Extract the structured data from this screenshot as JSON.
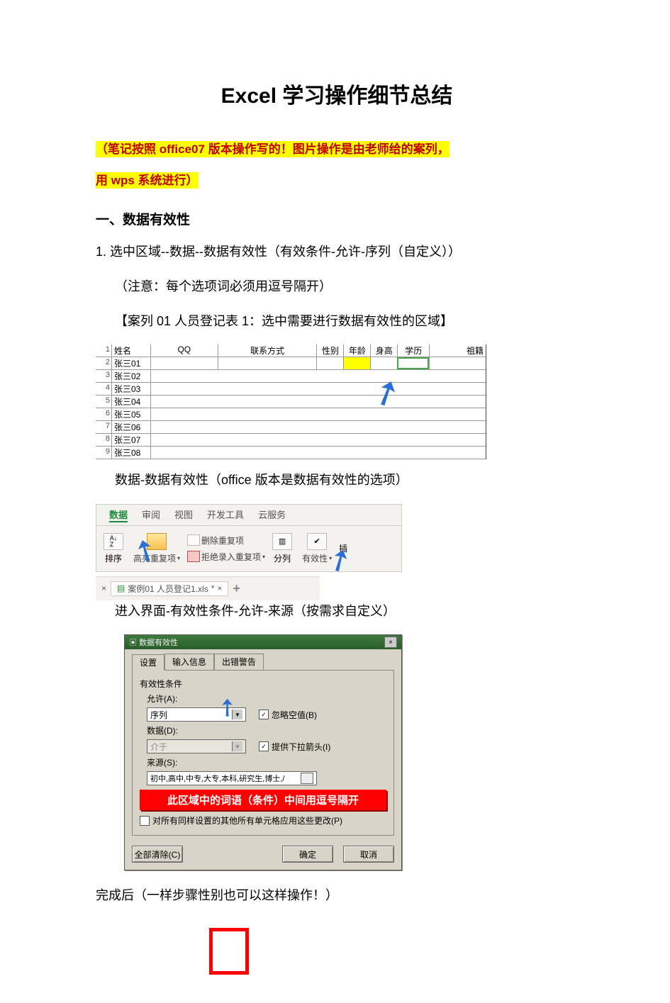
{
  "title": "Excel 学习操作细节总结",
  "highlight_line1": "（笔记按照 office07 版本操作写的！图片操作是由老师给的案列，",
  "highlight_line2": "用 wps 系统进行）",
  "section1_head": "一、数据有效性",
  "line_1_1": "1. 选中区域--数据--数据有效性（有效条件-允许-序列（自定义））",
  "line_1_2": "（注意：每个选项词必须用逗号隔开）",
  "case_title": "【案列 01 人员登记表 1：选中需要进行数据有效性的区域】",
  "sheet": {
    "headers": {
      "name": "姓名",
      "qq": "QQ",
      "contact": "联系方式",
      "sex": "性别",
      "age": "年龄",
      "height": "身高",
      "edu": "学历",
      "home": "祖籍"
    },
    "rows": [
      {
        "num": "2",
        "name": "张三01"
      },
      {
        "num": "3",
        "name": "张三02"
      },
      {
        "num": "4",
        "name": "张三03"
      },
      {
        "num": "5",
        "name": "张三04"
      },
      {
        "num": "6",
        "name": "张三05"
      },
      {
        "num": "7",
        "name": "张三06"
      },
      {
        "num": "8",
        "name": "张三07"
      },
      {
        "num": "9",
        "name": "张三08"
      }
    ]
  },
  "line_2_1": "数据-数据有效性（office 版本是数据有效性的选项）",
  "ribbon": {
    "tabs": [
      "数据",
      "审阅",
      "视图",
      "开发工具",
      "云服务"
    ],
    "active_tab": "数据",
    "sort_label": "排序",
    "highlight_dup": "高亮重复项",
    "remove_dup": "删除重复项",
    "reject_dup": "拒绝录入重复项",
    "split_col": "分列",
    "validity": "有效性",
    "more": "插"
  },
  "file_tab": {
    "close": "×",
    "name": "案例01 人员登记1.xls",
    "star": "*",
    "close2": "×",
    "plus": "+"
  },
  "line_3_1": "进入界面-有效性条件-允许-来源（按需求自定义）",
  "dialog": {
    "title": "数据有效性",
    "tab_settings": "设置",
    "tab_input": "输入信息",
    "tab_error": "出错警告",
    "group_label": "有效性条件",
    "allow_label": "允许(A):",
    "allow_value": "序列",
    "data_label": "数据(D):",
    "data_value": "介于",
    "ignore_blank": "忽略空值(B)",
    "provide_dd": "提供下拉箭头(I)",
    "source_label": "来源(S):",
    "source_value": "初中,高中,中专,大专,本科,研究生,博士,/",
    "red_note": "此区域中的词语（条件）中间用逗号隔开",
    "apply_all": "对所有同样设置的其他所有单元格应用这些更改(P)",
    "clear_all": "全部清除(C)",
    "ok": "确定",
    "cancel": "取消"
  },
  "line_4_1": "完成后（一样步骤性别也可以这样操作！）"
}
